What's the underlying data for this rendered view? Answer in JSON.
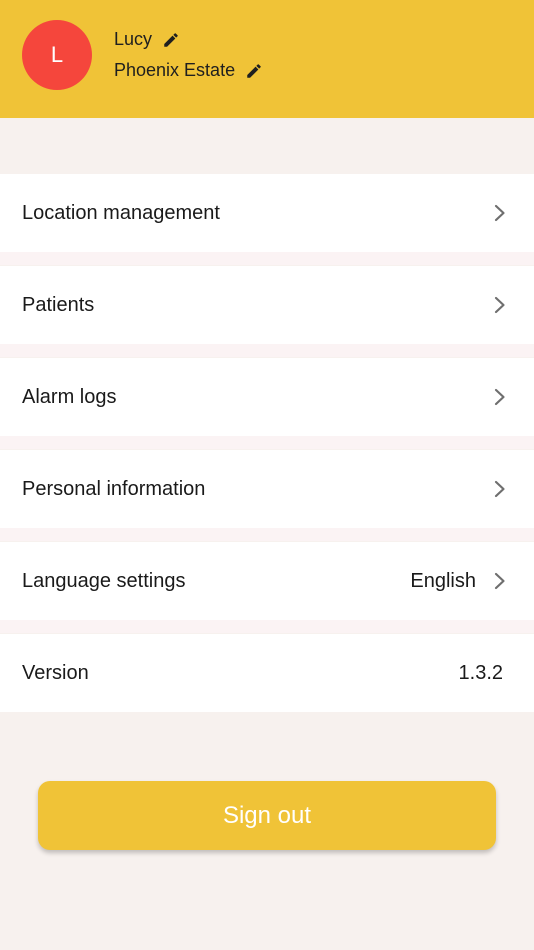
{
  "profile": {
    "avatar_initial": "L",
    "name": "Lucy",
    "organization": "Phoenix Estate"
  },
  "menu": {
    "location_management": "Location management",
    "patients": "Patients",
    "alarm_logs": "Alarm logs",
    "personal_information": "Personal information",
    "language_settings": "Language settings",
    "language_value": "English",
    "version_label": "Version",
    "version_value": "1.3.2"
  },
  "actions": {
    "sign_out": "Sign out"
  },
  "colors": {
    "brand_yellow": "#f0c337",
    "avatar_red": "#f5463c",
    "page_background": "#f7f1ee"
  },
  "icons": {
    "edit": "pencil-icon",
    "chevron": "chevron-right-icon"
  }
}
